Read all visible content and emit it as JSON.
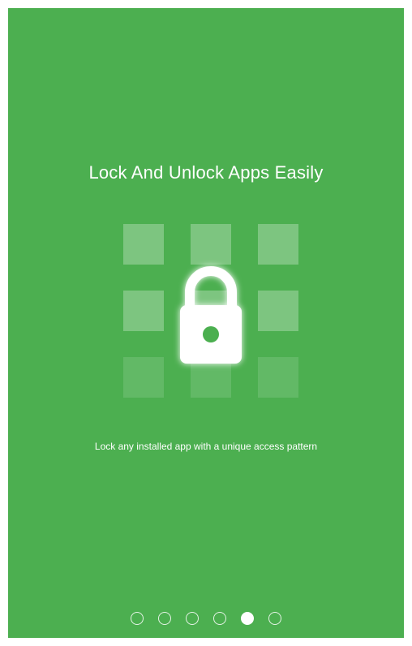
{
  "onboarding": {
    "title": "Lock And Unlock Apps Easily",
    "subtitle": "Lock any installed app with a unique access pattern",
    "illustration_icon": "padlock-icon",
    "background_color": "#4caf50",
    "page_indicator": {
      "total_pages": 6,
      "current_page": 5
    }
  }
}
